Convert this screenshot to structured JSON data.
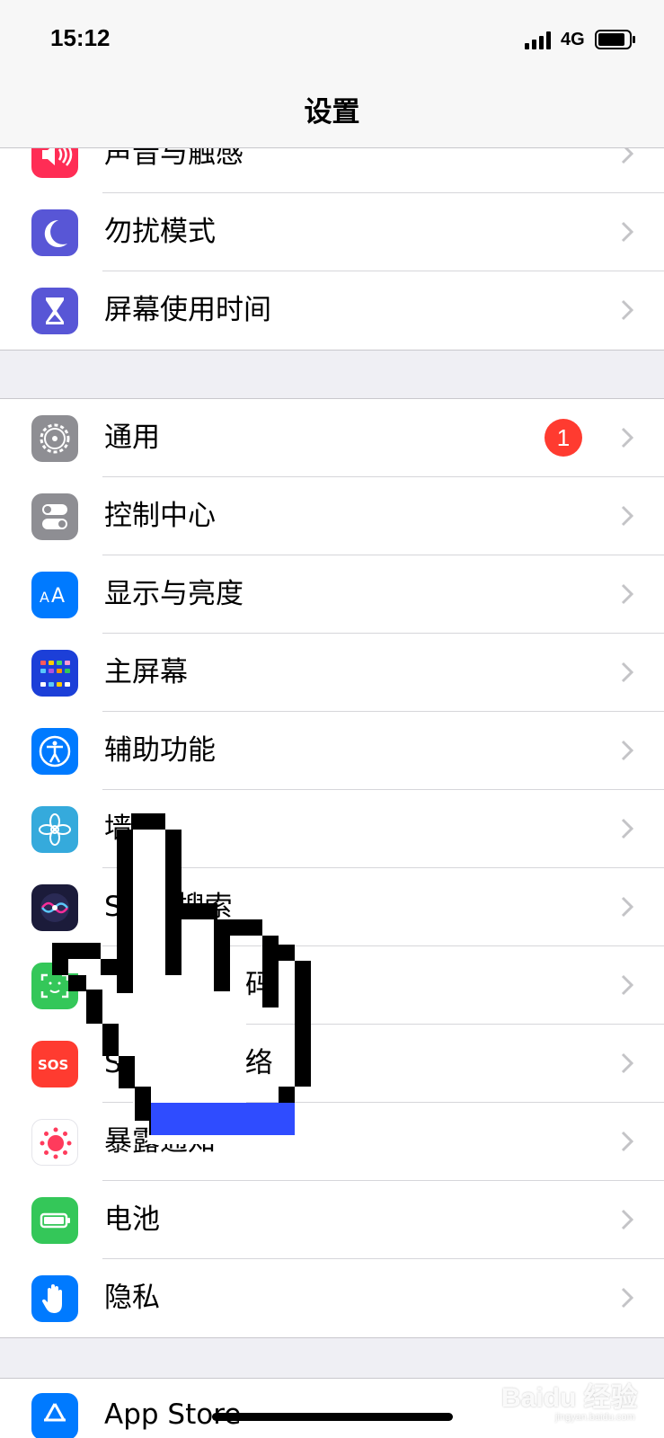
{
  "status_bar": {
    "time": "15:12",
    "network": "4G"
  },
  "nav": {
    "title": "设置"
  },
  "groups": [
    {
      "items": [
        {
          "label": "声音与触感",
          "icon": "speaker-icon",
          "color": "#ff2d55"
        },
        {
          "label": "勿扰模式",
          "icon": "moon-icon",
          "color": "#5856d6"
        },
        {
          "label": "屏幕使用时间",
          "icon": "hourglass-icon",
          "color": "#5856d6"
        }
      ]
    },
    {
      "items": [
        {
          "label": "通用",
          "icon": "gear-icon",
          "color": "#8e8e93",
          "badge": "1"
        },
        {
          "label": "控制中心",
          "icon": "toggles-icon",
          "color": "#8e8e93"
        },
        {
          "label": "显示与亮度",
          "icon": "text-size-icon",
          "color": "#007aff"
        },
        {
          "label": "主屏幕",
          "icon": "home-grid-icon",
          "color": "#1c3fd8"
        },
        {
          "label": "辅助功能",
          "icon": "accessibility-icon",
          "color": "#007aff"
        },
        {
          "label": "墙纸",
          "icon": "flower-icon",
          "color": "#35aadc"
        },
        {
          "label": "Siri与搜索",
          "icon": "siri-icon",
          "color": "#1b1b3a"
        },
        {
          "label": "面容ID与密码",
          "icon": "face-id-icon",
          "color": "#34c759"
        },
        {
          "label": "SOS紧急联络",
          "icon": "sos-icon",
          "color": "#ff3b30"
        },
        {
          "label": "暴露通知",
          "icon": "exposure-icon",
          "color": "#ffffff"
        },
        {
          "label": "电池",
          "icon": "battery-icon",
          "color": "#34c759"
        },
        {
          "label": "隐私",
          "icon": "hand-icon",
          "color": "#007aff"
        }
      ]
    }
  ],
  "partial_next": {
    "label": "App Store",
    "icon": "app-store-icon",
    "color": "#007aff"
  },
  "watermark": {
    "brand": "Baidu 经验",
    "sub": "jingyan.baidu.com"
  }
}
